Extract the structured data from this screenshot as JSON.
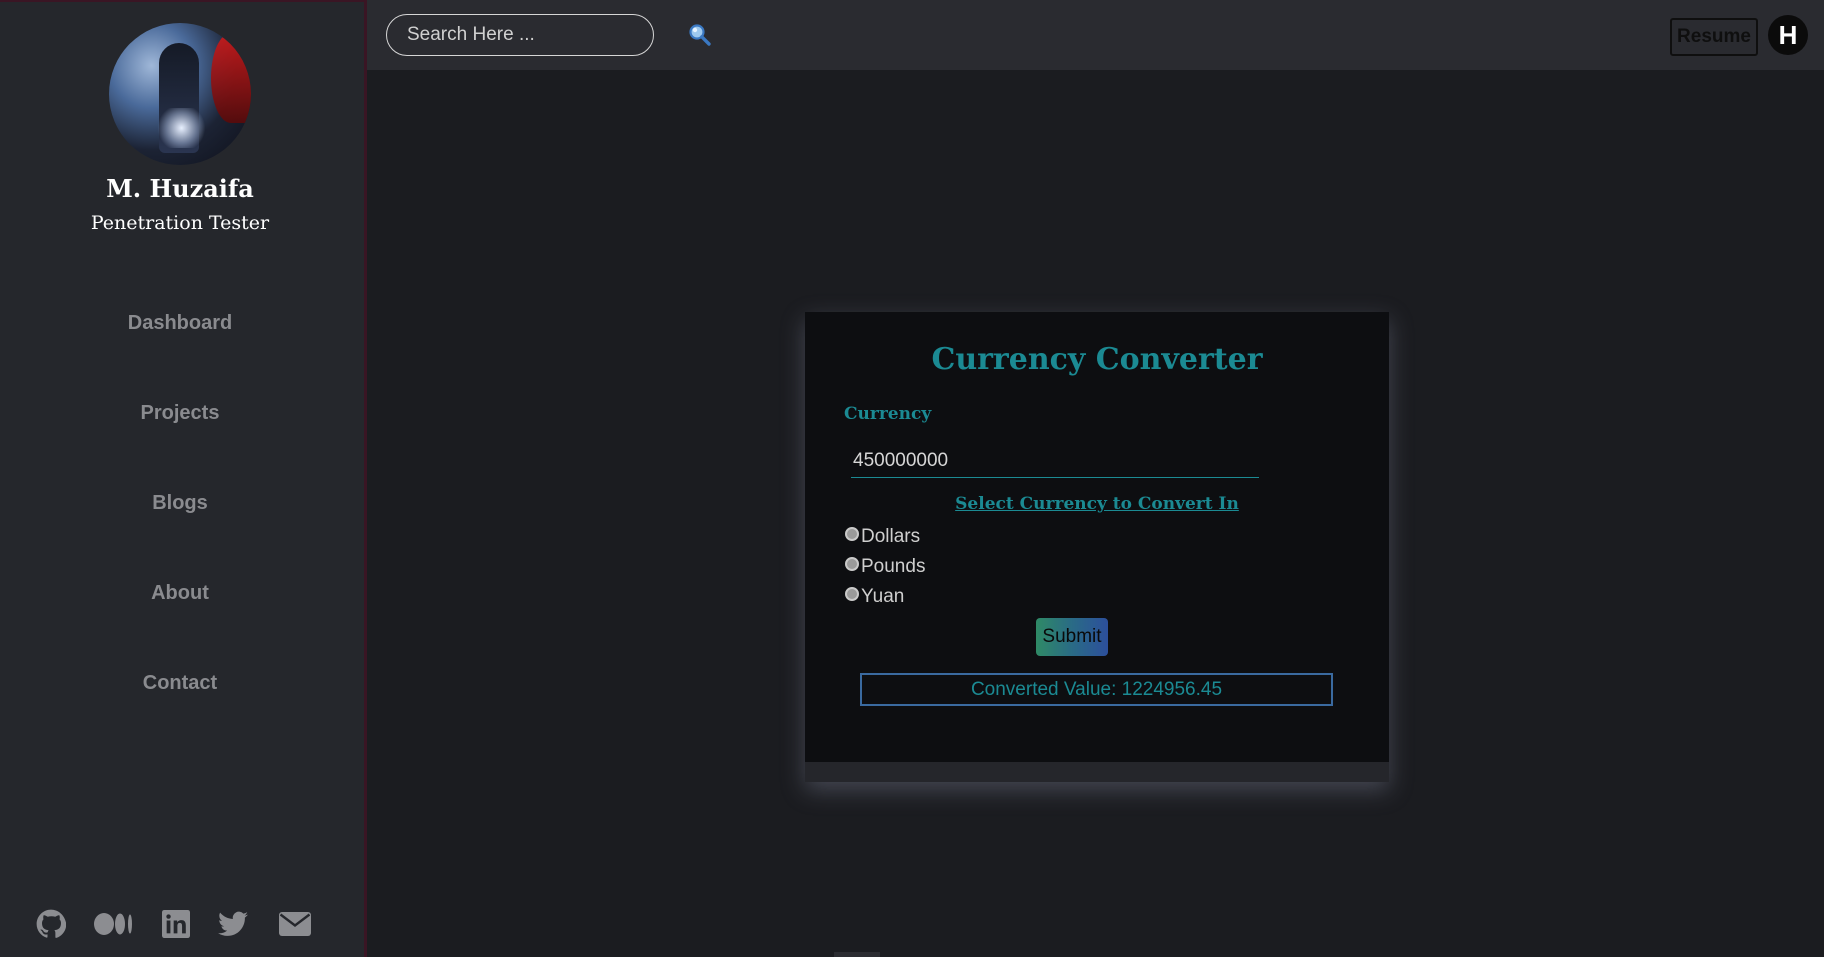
{
  "profile": {
    "name": "M. Huzaifa",
    "role": "Penetration Tester"
  },
  "sidebar": {
    "items": [
      {
        "label": "Dashboard"
      },
      {
        "label": "Projects"
      },
      {
        "label": "Blogs"
      },
      {
        "label": "About"
      },
      {
        "label": "Contact"
      }
    ],
    "social_icons": [
      "github-icon",
      "medium-icon",
      "linkedin-icon",
      "twitter-icon",
      "mail-icon"
    ]
  },
  "topbar": {
    "search_placeholder": "Search Here ...",
    "search_icon": "magnifier-icon",
    "resume_label": "Resume",
    "user_initial": "H"
  },
  "converter": {
    "title": "Currency Converter",
    "field_label": "Currency",
    "amount_value": "450000000",
    "select_title": "Select Currency to Convert In",
    "options": [
      {
        "label": "Dollars"
      },
      {
        "label": "Pounds"
      },
      {
        "label": "Yuan"
      }
    ],
    "submit_label": "Submit",
    "result_text": "Converted Value: 1224956.45"
  },
  "colors": {
    "accent": "#1b8a93",
    "sidebar_bg": "#25272c",
    "page_bg": "#1b1c20",
    "card_bg": "#0d0e11"
  }
}
